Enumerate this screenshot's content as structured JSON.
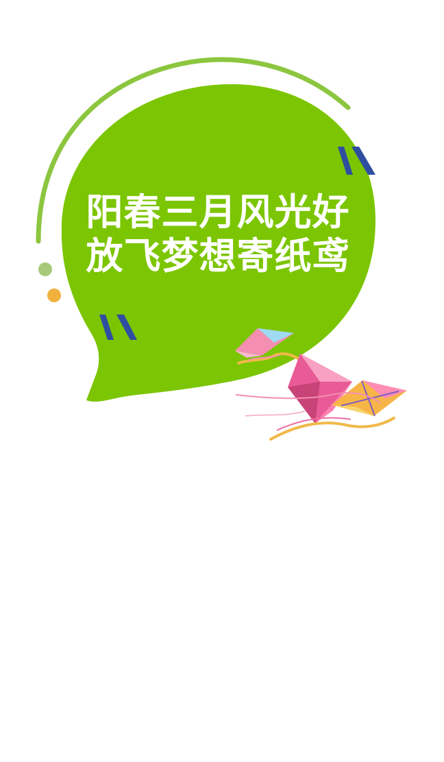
{
  "headline": {
    "line1": "阳春三月风光好",
    "line2": "放飞梦想寄纸鸢"
  },
  "colors": {
    "bubble": "#7cc502",
    "arc": "#8cc63f",
    "quote_mark": "#2e4fa0",
    "dot_green": "#a8c97a",
    "dot_orange": "#f0b13f",
    "text": "#ffffff",
    "background": "#ffffff"
  },
  "decorations": {
    "icons": [
      "speech-bubble",
      "quote-marks",
      "kites",
      "dots",
      "arc"
    ]
  }
}
